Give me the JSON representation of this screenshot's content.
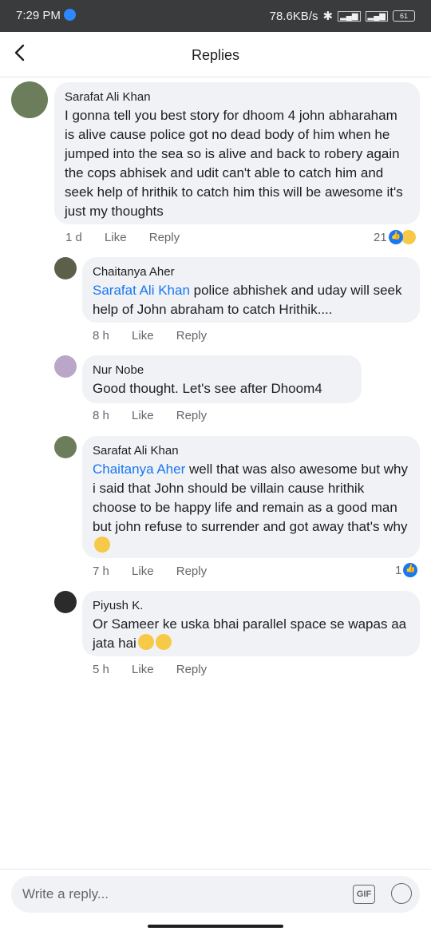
{
  "status": {
    "time": "7:29 PM",
    "speed": "78.6KB/s",
    "battery": "61"
  },
  "header": {
    "title": "Replies"
  },
  "comments": [
    {
      "name": "Sarafat Ali Khan",
      "mention": "",
      "text": "I gonna tell you best story for dhoom 4  john abharaham is alive cause police got no dead body of him when he jumped into the sea so is alive and back to robery again the cops abhisek and udit can't able to catch him and seek help of hrithik to catch him this will be awesome it's just my thoughts",
      "time": "1 d",
      "like": "Like",
      "reply": "Reply",
      "reactions": "21"
    },
    {
      "name": "Chaitanya Aher",
      "mention": "Sarafat Ali Khan",
      "text": " police abhishek and uday will seek help of John abraham to catch Hrithik....",
      "time": "8 h",
      "like": "Like",
      "reply": "Reply"
    },
    {
      "name": "Nur Nobe",
      "mention": "",
      "text": "Good thought. Let's see after Dhoom4",
      "time": "8 h",
      "like": "Like",
      "reply": "Reply"
    },
    {
      "name": "Sarafat Ali Khan",
      "mention": "Chaitanya Aher",
      "text": " well that was also awesome but why i said that John should be villain cause hrithik choose to be happy life and remain as a good man but john refuse to surrender and got away that's why",
      "time": "7 h",
      "like": "Like",
      "reply": "Reply",
      "reactions": "1"
    },
    {
      "name": "Piyush K.",
      "mention": "",
      "text": "Or Sameer ke uska bhai parallel space se wapas aa jata hai",
      "time": "5 h",
      "like": "Like",
      "reply": "Reply"
    }
  ],
  "composer": {
    "placeholder": "Write a reply...",
    "gif": "GIF"
  }
}
